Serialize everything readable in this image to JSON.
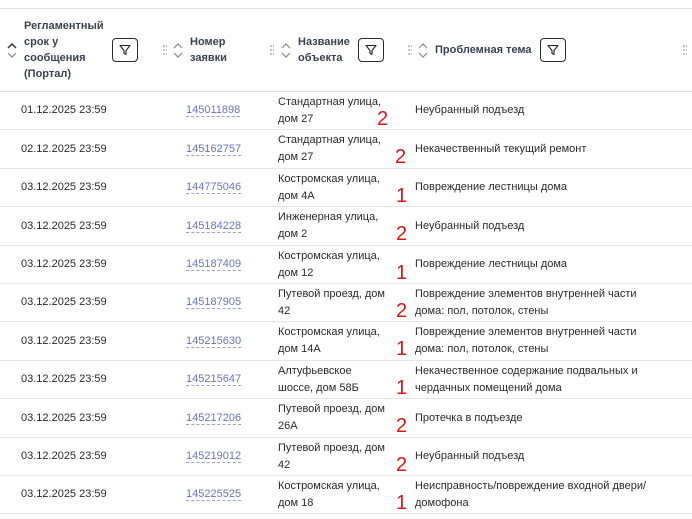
{
  "header": {
    "deadline": "Регламентный срок у сообщения (Портал)",
    "number": "Номер заявки",
    "object": "Название объекта",
    "topic": "Проблемная тема"
  },
  "rows": [
    {
      "date": "01.12.2025 23:59",
      "number": "145011898",
      "object": "Стандартная улица, дом 27",
      "topic": "Неубранный подъезд",
      "mark": "2"
    },
    {
      "date": "02.12.2025 23:59",
      "number": "145162757",
      "object": "Стандартная улица, дом 27",
      "topic": "Некачественный текущий ремонт",
      "mark": "2"
    },
    {
      "date": "03.12.2025 23:59",
      "number": "144775046",
      "object": "Костромская улица, дом 4А",
      "topic": "Повреждение лестницы дома",
      "mark": "1"
    },
    {
      "date": "03.12.2025 23:59",
      "number": "145184228",
      "object": "Инженерная улица, дом 2",
      "topic": "Неубранный подъезд",
      "mark": "2"
    },
    {
      "date": "03.12.2025 23:59",
      "number": "145187409",
      "object": "Костромская улица, дом 12",
      "topic": "Повреждение лестницы дома",
      "mark": "1"
    },
    {
      "date": "03.12.2025 23:59",
      "number": "145187905",
      "object": "Путевой проезд, дом 42",
      "topic": "Повреждение элементов внутренней части дома: пол, потолок, стены",
      "mark": "2"
    },
    {
      "date": "03.12.2025 23:59",
      "number": "145215630",
      "object": "Костромская улица, дом 14А",
      "topic": "Повреждение элементов внутренней части дома: пол, потолок, стены",
      "mark": "1"
    },
    {
      "date": "03.12.2025 23:59",
      "number": "145215647",
      "object": "Алтуфьевское шоссе, дом 58Б",
      "topic": "Некачественное содержание подвальных и чердачных помещений дома",
      "mark": "1"
    },
    {
      "date": "03.12.2025 23:59",
      "number": "145217206",
      "object": "Путевой проезд, дом 26А",
      "topic": "Протечка в подъезде",
      "mark": "2"
    },
    {
      "date": "03.12.2025 23:59",
      "number": "145219012",
      "object": "Путевой проезд, дом 42",
      "topic": "Неубранный подъезд",
      "mark": "2"
    },
    {
      "date": "03.12.2025 23:59",
      "number": "145225525",
      "object": "Костромская улица, дом 18",
      "topic": "Неисправность/повреждение входной двери/домофона",
      "mark": "1"
    }
  ]
}
